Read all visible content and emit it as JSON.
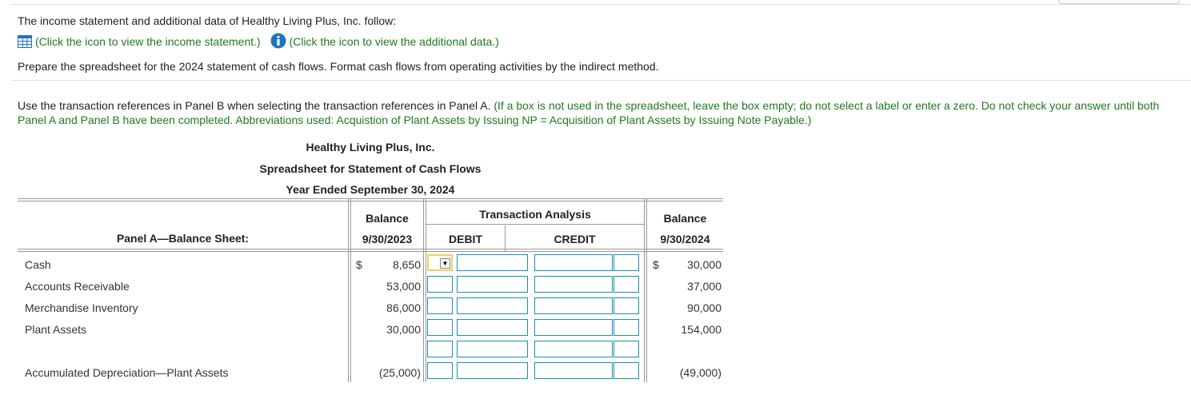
{
  "intro": {
    "line1": "The income statement and additional data of Healthy Living Plus, Inc. follow:",
    "income_link": "(Click the icon to view the income statement.)",
    "data_link": "(Click the icon to view the additional data.)",
    "task": "Prepare the spreadsheet for the 2024 statement of cash flows. Format cash flows from operating activities by the indirect method."
  },
  "instructions": {
    "plain": "Use the transaction references in Panel B when selecting the transaction references in Panel A.",
    "green": "(If a box is not used in the spreadsheet, leave the box empty; do not select a label or enter a zero. Do not check your answer until both Panel A and Panel B have been completed. Abbreviations used: Acquistion of Plant Assets by Issuing NP = Acquisition of Plant Assets by Issuing Note Payable.)"
  },
  "heading": {
    "company": "Healthy Living Plus, Inc.",
    "report": "Spreadsheet for Statement of Cash Flows",
    "period": "Year Ended September 30, 2024"
  },
  "table": {
    "panel_label": "Panel A—Balance Sheet:",
    "bal_begin_1": "Balance",
    "bal_begin_2": "9/30/2023",
    "trans_title": "Transaction Analysis",
    "debit": "DEBIT",
    "credit": "CREDIT",
    "bal_end_1": "Balance",
    "bal_end_2": "9/30/2024",
    "dollar": "$",
    "rows": [
      {
        "label": "Cash",
        "begin": "8,650",
        "end": "30,000"
      },
      {
        "label": "Accounts Receivable",
        "begin": "53,000",
        "end": "37,000"
      },
      {
        "label": "Merchandise Inventory",
        "begin": "86,000",
        "end": "90,000"
      },
      {
        "label": "Plant Assets",
        "begin": "30,000",
        "end": "154,000"
      },
      {
        "label": "",
        "begin": "",
        "end": ""
      },
      {
        "label": "Accumulated Depreciation—Plant Assets",
        "begin": "(25,000)",
        "end": "(49,000)"
      }
    ]
  },
  "colors": {
    "accent_green": "#1e7a1e",
    "input_border": "#1a8fb0",
    "selected_border": "#f0d060",
    "info_blue": "#1e73be"
  }
}
